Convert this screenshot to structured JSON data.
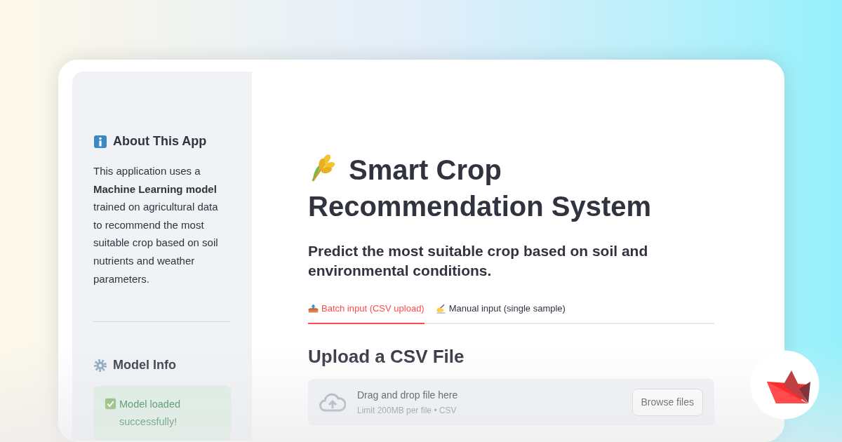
{
  "sidebar": {
    "about": {
      "heading": "About This App",
      "text": "This application uses a **Machine Learning model** trained on agricultural data to recommend the most suitable crop based on soil nutrients and weather parameters."
    },
    "model_info": {
      "heading": "Model Info",
      "status": {
        "kind": "success",
        "text": "Model loaded successfully!"
      }
    }
  },
  "main": {
    "title": "Smart Crop Recommendation System",
    "subtitle": "Predict the most suitable crop based on soil and environmental conditions.",
    "tabs": [
      {
        "label": "Batch input (CSV upload)",
        "selected": true
      },
      {
        "label": "Manual input (single sample)",
        "selected": false
      }
    ],
    "section_heading": "Upload a CSV File",
    "uploader": {
      "instruction": "Drag and drop file here",
      "limit": "Limit 200MB per file • CSV",
      "button": "Browse files"
    }
  }
}
